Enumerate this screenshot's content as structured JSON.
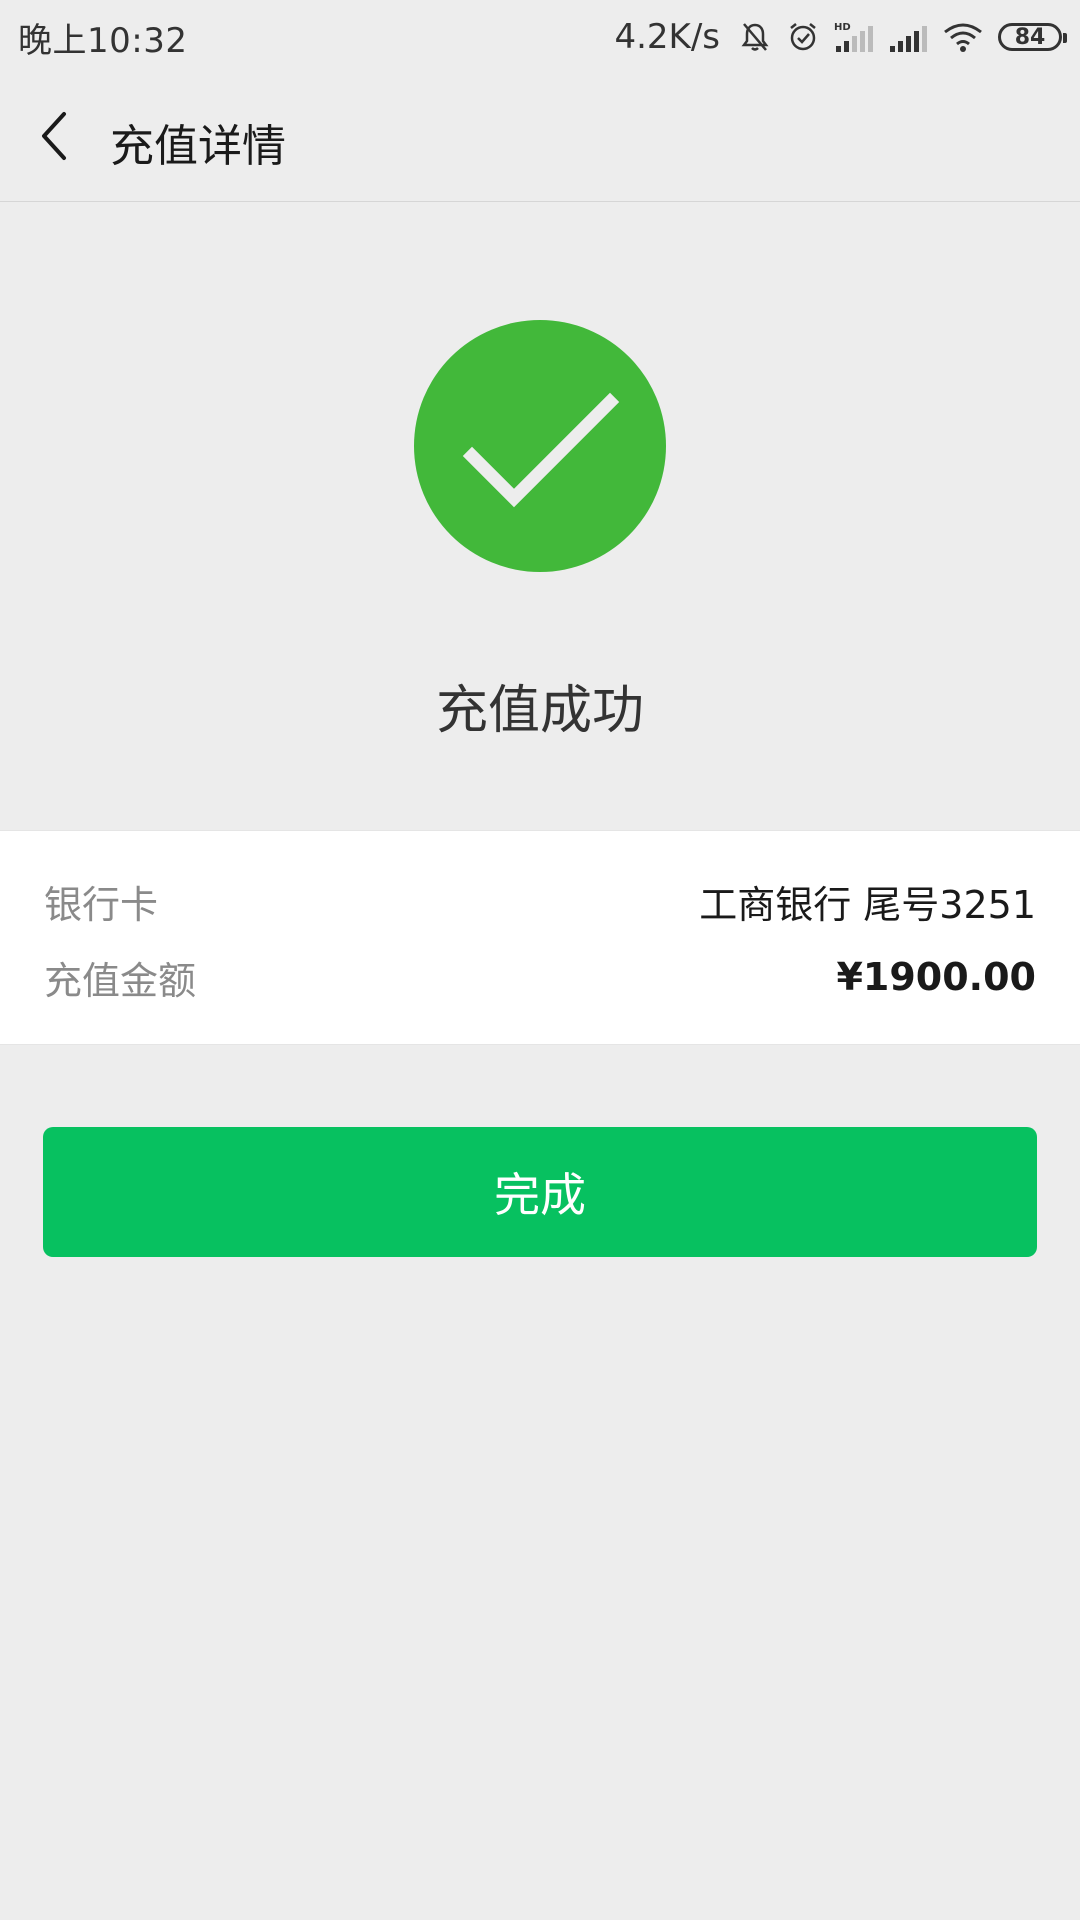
{
  "status_bar": {
    "time": "晚上10:32",
    "network_speed": "4.2K/s",
    "battery": "84",
    "icons": [
      "bell-muted-icon",
      "alarm-icon",
      "hd-signal-icon",
      "signal-icon",
      "wifi-icon",
      "battery-icon"
    ]
  },
  "nav": {
    "title": "充值详情",
    "back_icon": "chevron-left-icon"
  },
  "result": {
    "icon": "check-icon",
    "icon_color": "#42b83a",
    "message": "充值成功"
  },
  "details": {
    "bank_label": "银行卡",
    "bank_value": "工商银行 尾号3251",
    "amount_label": "充值金额",
    "amount_value": "¥1900.00"
  },
  "actions": {
    "done_label": "完成",
    "done_color": "#07c160"
  }
}
